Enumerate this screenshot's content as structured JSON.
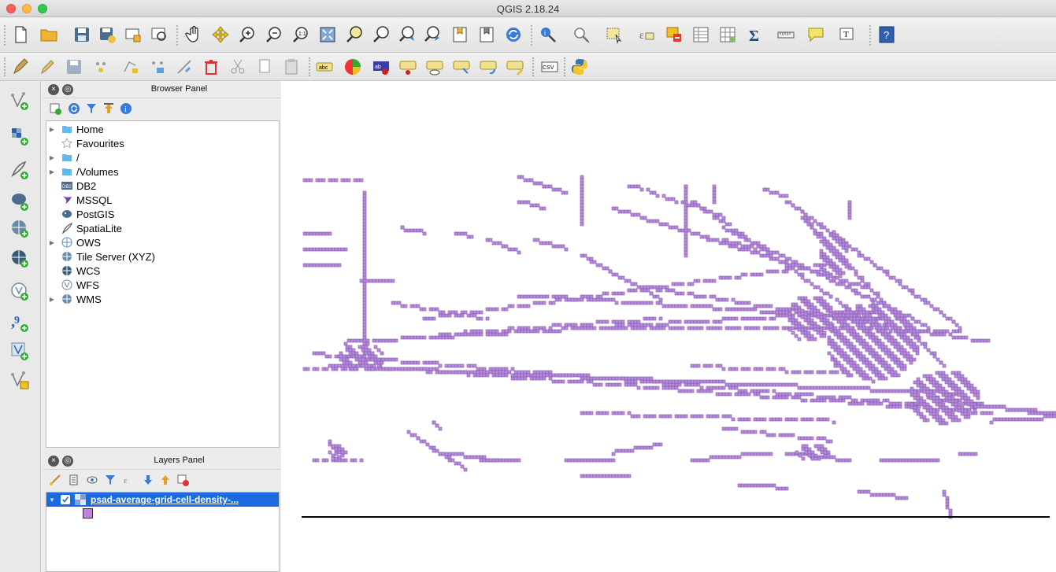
{
  "window": {
    "title": "QGIS 2.18.24"
  },
  "toolbar_icons": [
    "new-project-icon",
    "open-project-icon",
    "save-project-icon",
    "save-as-icon",
    "new-print-composer-icon",
    "composer-manager-icon",
    "pan-icon",
    "pan-to-selection-icon",
    "zoom-in-icon",
    "zoom-out-icon",
    "zoom-native-icon",
    "zoom-full-icon",
    "zoom-to-selection-icon",
    "zoom-to-layer-icon",
    "zoom-last-icon",
    "zoom-next-icon",
    "new-bookmark-icon",
    "show-bookmarks-icon",
    "refresh-icon",
    "identify-icon",
    "select-icon",
    "select-features-icon",
    "select-value-icon",
    "deselect-icon",
    "attribute-table-icon",
    "field-calculator-icon",
    "statistics-icon",
    "measure-icon",
    "map-tips-icon",
    "text-annotation-icon",
    "help-icon"
  ],
  "browser_panel": {
    "title": "Browser Panel",
    "items": [
      {
        "label": "Home",
        "icon": "folder-icon",
        "expandable": true
      },
      {
        "label": "Favourites",
        "icon": "star-icon",
        "expandable": false
      },
      {
        "label": "/",
        "icon": "folder-icon",
        "expandable": true
      },
      {
        "label": "/Volumes",
        "icon": "folder-icon",
        "expandable": true
      },
      {
        "label": "DB2",
        "icon": "db2-icon",
        "expandable": false
      },
      {
        "label": "MSSQL",
        "icon": "mssql-icon",
        "expandable": false
      },
      {
        "label": "PostGIS",
        "icon": "postgis-icon",
        "expandable": false
      },
      {
        "label": "SpatiaLite",
        "icon": "spatialite-icon",
        "expandable": false
      },
      {
        "label": "OWS",
        "icon": "ows-icon",
        "expandable": true
      },
      {
        "label": "Tile Server (XYZ)",
        "icon": "xyz-icon",
        "expandable": false
      },
      {
        "label": "WCS",
        "icon": "wcs-icon",
        "expandable": false
      },
      {
        "label": "WFS",
        "icon": "wfs-icon",
        "expandable": false
      },
      {
        "label": "WMS",
        "icon": "wms-icon",
        "expandable": true
      }
    ]
  },
  "layers_panel": {
    "title": "Layers Panel",
    "layer": {
      "name": "psad-average-grid-cell-density-...",
      "checked": true,
      "symbol_color": "#c080e0"
    }
  },
  "map": {
    "feature_fill": "#b48ed8",
    "feature_stroke": "#8a55b8",
    "background": "#ffffff"
  }
}
